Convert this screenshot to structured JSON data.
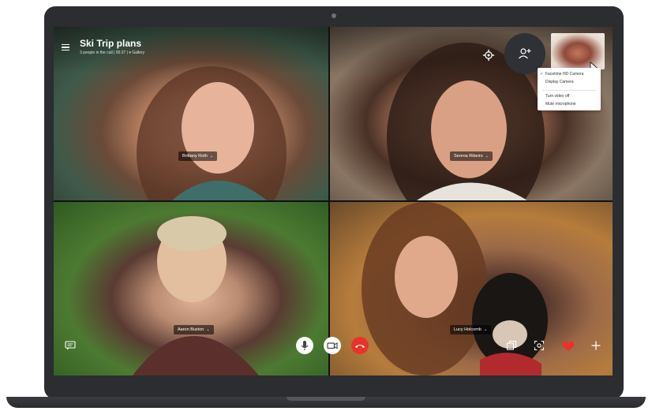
{
  "call": {
    "title": "Ski Trip plans",
    "subtitle": "3 people in the call | 00:27 | ▾ Gallery"
  },
  "participants": [
    {
      "name": "Brittany Roth"
    },
    {
      "name": "Serena Ribeiro"
    },
    {
      "name": "Aaron Buxton"
    },
    {
      "name": "Lucy Holcomb"
    }
  ],
  "camera_menu": {
    "items": [
      "Facetime HD Camera",
      "Display Camera",
      "Turn video off",
      "Mute microphone"
    ],
    "selected": "Facetime HD Camera"
  },
  "icons": {
    "menu": "hamburger-icon",
    "settings": "gear-icon",
    "add_people": "add-person-icon",
    "chat": "chat-icon",
    "mic": "microphone-icon",
    "video": "video-camera-icon",
    "hangup": "hang-up-icon",
    "share": "share-screen-icon",
    "snapshot": "snapshot-icon",
    "react": "heart-icon",
    "more": "plus-icon"
  },
  "colors": {
    "hangup": "#e8332c",
    "heart": "#e8332c",
    "control_bg": "#ffffff",
    "laptop": "#2b2d31"
  }
}
